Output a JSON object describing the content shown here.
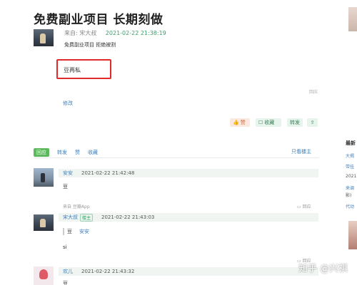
{
  "post": {
    "title": "免费副业项目 长期刻做",
    "meta_from": "来自: 宋大叔",
    "meta_time": "2021-02-22 21:38:19",
    "subtitle": "免费副业项目 拒绝被割",
    "highlight_text": "豆再私",
    "small_right": "回应",
    "edit": "修改",
    "actions": {
      "like": "赞",
      "fav": "收藏",
      "fwd": "转发",
      "share": "⇪"
    }
  },
  "tabs": {
    "reply": "回应",
    "forward": "转发",
    "like": "赞",
    "fav": "收藏",
    "only_author": "只看楼主"
  },
  "replies": [
    {
      "name": "安安",
      "time": "2021-02-22 21:42:48",
      "text": "豆",
      "source": "来自 豆瓣App",
      "reply": "回应"
    },
    {
      "name": "宋大叔",
      "badge": "楼主",
      "time": "2021-02-22 21:43:03",
      "quote_icon": "豆",
      "quote_name": "安安",
      "text": "si",
      "reply": "回应"
    },
    {
      "name": "欢儿",
      "time": "2021-02-22 21:43:32",
      "text": "豆"
    }
  ],
  "sidebar": {
    "heading": "最新",
    "links": [
      "大揭",
      "带挂",
      "2021",
      "来调",
      "影)",
      "代动"
    ]
  },
  "watermark": "知乎 @兴祺",
  "colors": {
    "highlight_border": "#e02a2a",
    "accent_green": "#3a9e6a",
    "link_blue": "#3a7fbf"
  }
}
